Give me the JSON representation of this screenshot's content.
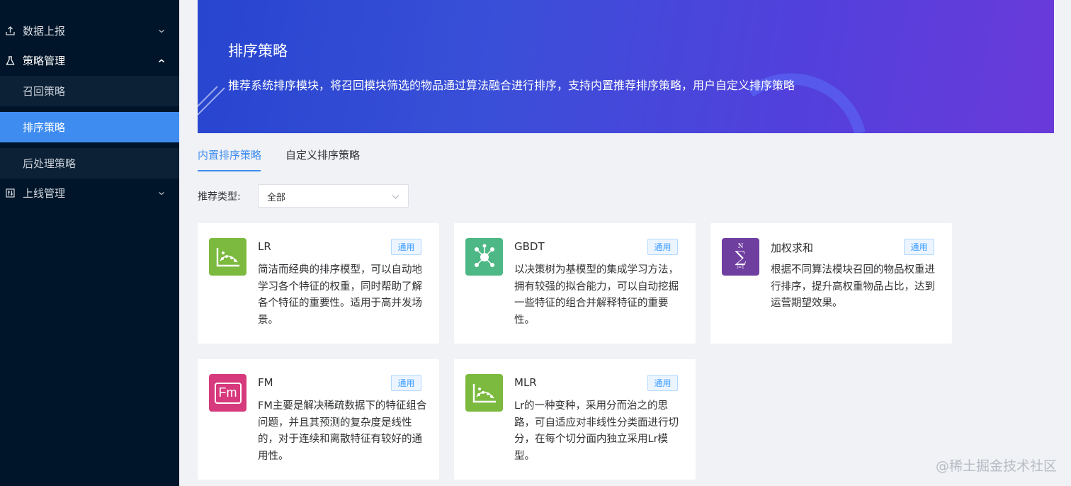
{
  "sidebar": {
    "items": [
      {
        "label": "数据上报",
        "icon": "upload-icon"
      },
      {
        "label": "策略管理",
        "icon": "flask-icon"
      },
      {
        "label": "上线管理",
        "icon": "sliders-icon"
      }
    ],
    "sub_items": [
      {
        "label": "召回策略"
      },
      {
        "label": "排序策略"
      },
      {
        "label": "后处理策略"
      }
    ],
    "colors": {
      "background": "#001529",
      "active": "#3f8cf0"
    }
  },
  "banner": {
    "title": "排序策略",
    "description": "推荐系统排序模块，将召回模块筛选的物品通过算法融合进行排序，支持内置推荐排序策略，用户自定义排序策略"
  },
  "tabs": [
    {
      "label": "内置排序策略"
    },
    {
      "label": "自定义排序策略"
    }
  ],
  "filter": {
    "label": "推荐类型:",
    "value": "全部"
  },
  "cards": [
    {
      "title": "LR",
      "tag": "通用",
      "icon": "chart-icon",
      "desc": "简洁而经典的排序模型，可以自动地学习各个特征的权重，同时帮助了解各个特征的重要性。适用于高并发场景。",
      "color": "#7cba3f"
    },
    {
      "title": "GBDT",
      "tag": "通用",
      "icon": "network-icon",
      "desc": "以决策树为基模型的集成学习方法，拥有较强的拟合能力，可以自动挖掘一些特征的组合并解释特征的重要性。",
      "color": "#4db885"
    },
    {
      "title": "加权求和",
      "tag": "通用",
      "icon": "sigma-icon",
      "icon_text": "N",
      "icon_text2": "∑",
      "icon_text3": "i=1",
      "desc": "根据不同算法模块召回的物品权重进行排序，提升高权重物品占比，达到运营期望效果。",
      "color": "#6f3fa0"
    },
    {
      "title": "FM",
      "tag": "通用",
      "icon": "fm-icon",
      "icon_text": "Fm",
      "desc": "FM主要是解决稀疏数据下的特征组合问题，并且其预测的复杂度是线性的，对于连续和离散特征有较好的通用性。",
      "color": "#d63a7c"
    },
    {
      "title": "MLR",
      "tag": "通用",
      "icon": "chart-icon",
      "desc": "Lr的一种变种，采用分而治之的思路，可自适应对非线性分类面进行切分，在每个切分面内独立采用Lr模型。",
      "color": "#7cba3f"
    }
  ],
  "watermark": "@稀土掘金技术社区"
}
